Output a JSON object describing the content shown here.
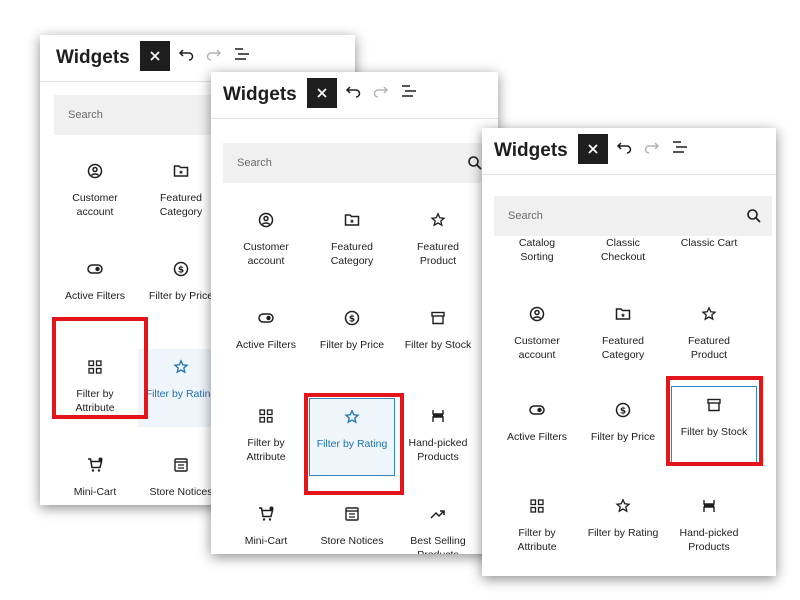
{
  "panels": [
    {
      "title": "Widgets",
      "search_placeholder": "Search",
      "items": [
        {
          "label": "Customer\naccount",
          "icon": "user-circle-icon"
        },
        {
          "label": "Featured\nCategory",
          "icon": "folder-star-icon"
        },
        {
          "label": "Active Filters",
          "icon": "toggle-icon"
        },
        {
          "label": "Filter by Price",
          "icon": "dollar-circle-icon"
        },
        {
          "label": "Filter by\nAttribute",
          "icon": "grid-icon"
        },
        {
          "label": "Filter by Rating",
          "icon": "star-icon"
        },
        {
          "label": "Mini-Cart",
          "icon": "cart-icon"
        },
        {
          "label": "Store Notices",
          "icon": "notice-icon"
        }
      ]
    },
    {
      "title": "Widgets",
      "search_placeholder": "Search",
      "items": [
        {
          "label": "Customer\naccount",
          "icon": "user-circle-icon"
        },
        {
          "label": "Featured\nCategory",
          "icon": "folder-star-icon"
        },
        {
          "label": "Featured\nProduct",
          "icon": "star-icon"
        },
        {
          "label": "Active Filters",
          "icon": "toggle-icon"
        },
        {
          "label": "Filter by Price",
          "icon": "dollar-circle-icon"
        },
        {
          "label": "Filter by Stock",
          "icon": "box-icon"
        },
        {
          "label": "Filter by\nAttribute",
          "icon": "grid-icon"
        },
        {
          "label": "Filter by Rating",
          "icon": "star-icon"
        },
        {
          "label": "Hand-picked\nProducts",
          "icon": "hand-picked-icon"
        },
        {
          "label": "Mini-Cart",
          "icon": "cart-icon"
        },
        {
          "label": "Store Notices",
          "icon": "notice-icon"
        },
        {
          "label": "Best Selling\nProducts",
          "icon": "trend-icon"
        }
      ]
    },
    {
      "title": "Widgets",
      "search_placeholder": "Search",
      "partial_labels": [
        "Catalog\nSorting",
        "Classic\nCheckout",
        "Classic Cart"
      ],
      "items": [
        {
          "label": "Customer\naccount",
          "icon": "user-circle-icon"
        },
        {
          "label": "Featured\nCategory",
          "icon": "folder-star-icon"
        },
        {
          "label": "Featured\nProduct",
          "icon": "star-icon"
        },
        {
          "label": "Active Filters",
          "icon": "toggle-icon"
        },
        {
          "label": "Filter by Price",
          "icon": "dollar-circle-icon"
        },
        {
          "label": "Filter by Stock",
          "icon": "box-icon"
        },
        {
          "label": "Filter by\nAttribute",
          "icon": "grid-icon"
        },
        {
          "label": "Filter by Rating",
          "icon": "star-icon"
        },
        {
          "label": "Hand-picked\nProducts",
          "icon": "hand-picked-icon"
        }
      ]
    }
  ],
  "colors": {
    "highlight_border": "#e3151a",
    "selection_border": "#3582c4",
    "selection_bg": "#eef5fb",
    "accent_text": "#2271b1",
    "close_bg": "#1e1e1e"
  }
}
